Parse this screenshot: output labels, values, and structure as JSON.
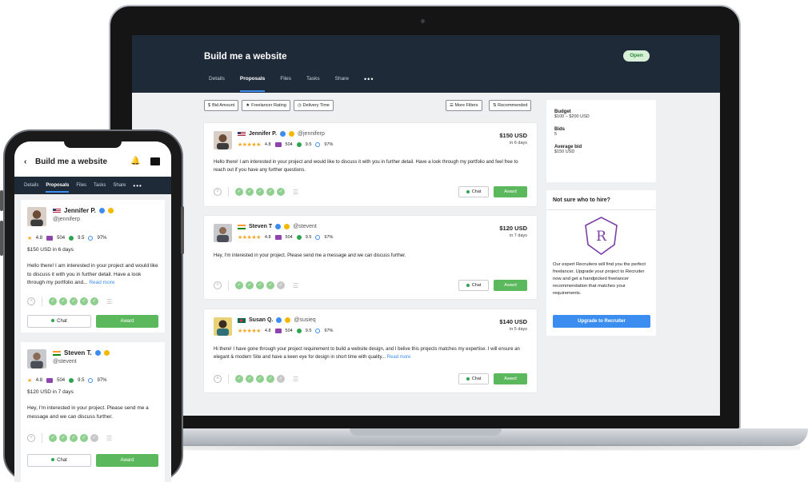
{
  "project": {
    "title": "Build me a website",
    "status": "Open"
  },
  "tabs": [
    "Details",
    "Proposals",
    "Files",
    "Tasks",
    "Share"
  ],
  "filters": [
    "Bid Amount",
    "Freelancer Rating",
    "Delivery Time"
  ],
  "sort": {
    "more_filters": "More Filters",
    "recommended": "Recommended"
  },
  "proposals": [
    {
      "name": "Jennifer P.",
      "handle": "@jenniferp",
      "rating": "4.8",
      "reviews": "504",
      "score": "9.5",
      "completion": "97%",
      "price": "$150 USD",
      "days": "in 6 days",
      "text": "Hello there! I am interested in your project and would like to discuss it with you in further detail. Have a look through my portfolio and feel free to reach out if you have any further questions.",
      "more": ""
    },
    {
      "name": "Steven T",
      "handle": "@stevent",
      "rating": "4.8",
      "reviews": "504",
      "score": "9.5",
      "completion": "97%",
      "price": "$120 USD",
      "days": "in 7 days",
      "text": "Hey, I'm interested in your project. Please send me a message and we can discuss further.",
      "more": ""
    },
    {
      "name": "Susan Q.",
      "handle": "@susieq",
      "rating": "4.8",
      "reviews": "504",
      "score": "9.5",
      "completion": "97%",
      "price": "$140 USD",
      "days": "in 5 days",
      "text": "Hi there! I have gone through your project requirement to build a website design, and I belive this projects matches my expertise. I will ensure an elegant & modern Site and have a keen eye for design in short time with quality...",
      "more": "Read more"
    }
  ],
  "actions": {
    "chat": "Chat",
    "award": "Award"
  },
  "summary": {
    "budget_label": "Budget",
    "budget_value": "$100 – $200 USD",
    "bids_label": "Bids",
    "bids_value": "5",
    "avg_label": "Average bid",
    "avg_value": "$150 USD"
  },
  "recruiter": {
    "title": "Not sure who to hire?",
    "badge_letter": "R",
    "text": "Our expert Recruiters will find you the perfect freelancer. Upgrade your project to Recruiter now and get a handpicked freelancer recommendation that matches your requirements.",
    "button": "Upgrade to Recruiter"
  },
  "mobile": {
    "back": "‹",
    "title": "Build me a website",
    "cards": [
      {
        "name": "Jennifer P.",
        "handle": "@jenniferp",
        "rating": "4.8",
        "reviews": "504",
        "score": "9.5",
        "completion": "97%",
        "price": "$150 USD",
        "days": "in 6 days",
        "text": "Hello there! I am interested in your project and would like to discuss it with you in further detail. Have a look through my portfolio and...",
        "more": "Read more"
      },
      {
        "name": "Steven T.",
        "handle": "@stevent",
        "rating": "4.8",
        "reviews": "504",
        "score": "9.5",
        "completion": "97%",
        "price": "$120 USD",
        "days": "in 7 days",
        "text": "Hey, I'm interested in your project. Please send me a message and we can discuss further.",
        "more": ""
      }
    ]
  },
  "icons": {
    "star": "star-icon",
    "verified": "verified-icon",
    "preferred": "preferred-icon"
  },
  "colors": {
    "header": "#1f2a38",
    "accent": "#3b8df0",
    "award": "#5cb85c",
    "star": "#f5a623",
    "open_bg": "#d8f0d8"
  }
}
